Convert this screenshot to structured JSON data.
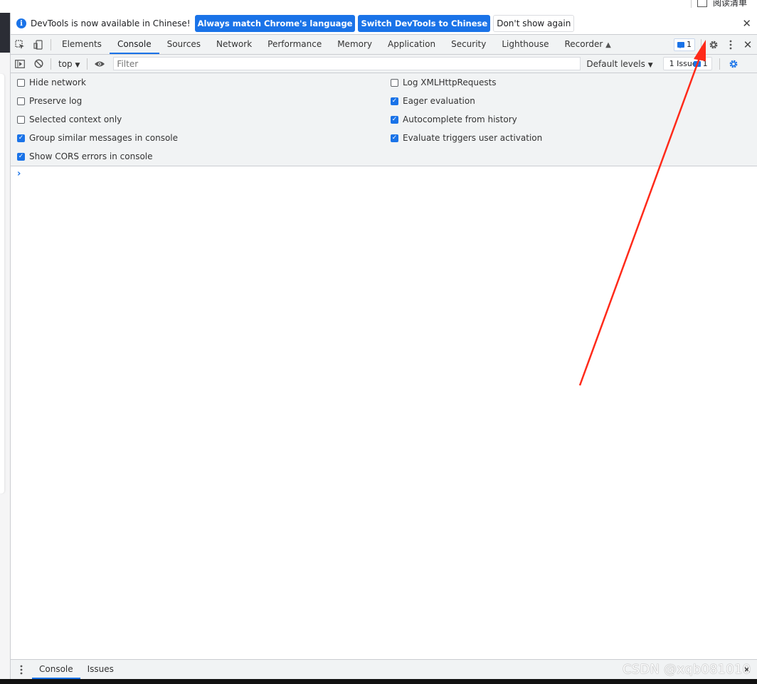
{
  "page": {
    "top_right_text": "阅读清单"
  },
  "infobar": {
    "message": "DevTools is now available in Chinese!",
    "btn_match": "Always match Chrome's language",
    "btn_switch": "Switch DevTools to Chinese",
    "btn_dismiss": "Don't show again"
  },
  "tabs": [
    "Elements",
    "Console",
    "Sources",
    "Network",
    "Performance",
    "Memory",
    "Application",
    "Security",
    "Lighthouse",
    "Recorder"
  ],
  "tabbar": {
    "messages_count": "1"
  },
  "console_toolbar": {
    "context": "top",
    "filter_placeholder": "Filter",
    "levels": "Default levels",
    "issues_label": "1 Issue:",
    "issues_count": "1"
  },
  "settings": {
    "left": [
      {
        "label": "Hide network",
        "checked": false
      },
      {
        "label": "Preserve log",
        "checked": false
      },
      {
        "label": "Selected context only",
        "checked": false
      },
      {
        "label": "Group similar messages in console",
        "checked": true
      },
      {
        "label": "Show CORS errors in console",
        "checked": true
      }
    ],
    "right": [
      {
        "label": "Log XMLHttpRequests",
        "checked": false
      },
      {
        "label": "Eager evaluation",
        "checked": true
      },
      {
        "label": "Autocomplete from history",
        "checked": true
      },
      {
        "label": "Evaluate triggers user activation",
        "checked": true
      }
    ]
  },
  "prompt_symbol": "›",
  "drawer": {
    "tab_console": "Console",
    "tab_issues": "Issues"
  },
  "watermark": "CSDN @xqb081010",
  "colors": {
    "accent": "#1a73e8",
    "annotation_arrow": "#ff2a1a"
  }
}
